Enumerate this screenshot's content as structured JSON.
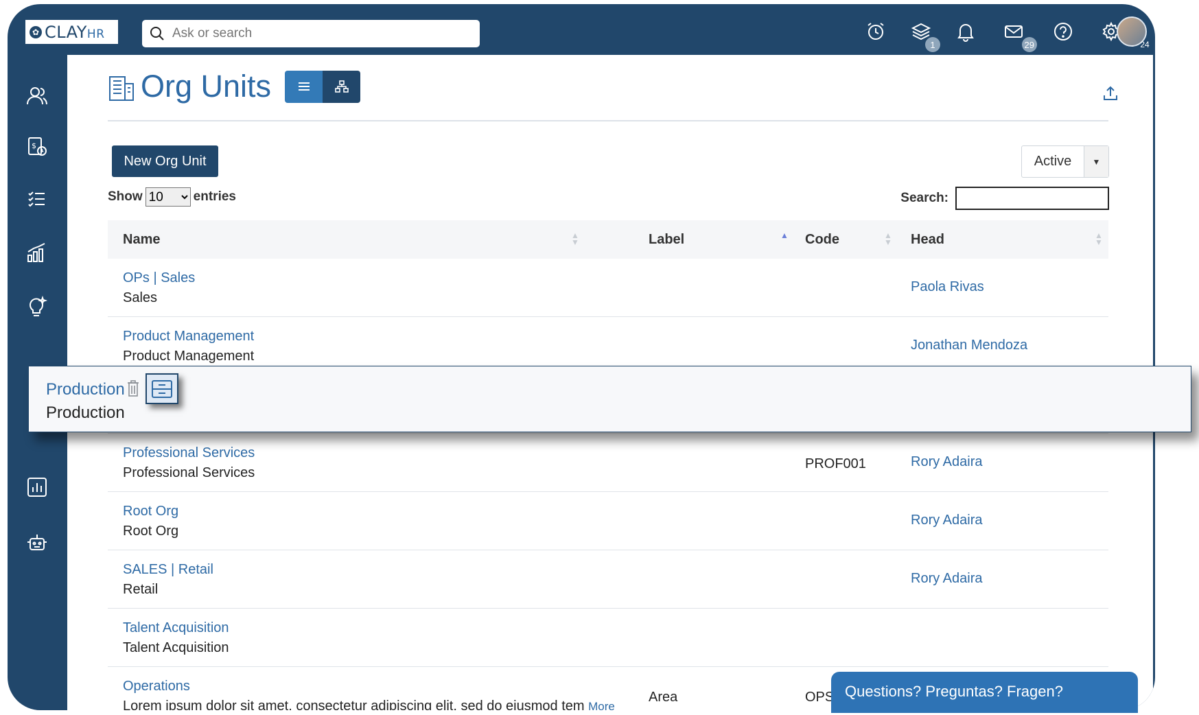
{
  "app": {
    "logo_text": "CLAY",
    "logo_suffix": "HR",
    "search_placeholder": "Ask or search"
  },
  "topbar": {
    "badges": {
      "layers": "1",
      "mail": "29",
      "avatar": "24"
    }
  },
  "page": {
    "title": "Org Units",
    "new_button": "New Org Unit",
    "status_filter": "Active",
    "show_label": "Show",
    "entries_label": "entries",
    "page_size": "10",
    "page_size_options": [
      "10"
    ],
    "search_label": "Search:"
  },
  "table": {
    "columns": [
      "Name",
      "Label",
      "Code",
      "Head"
    ],
    "rows": [
      {
        "name": "OPs | Sales",
        "sub": "Sales",
        "label": "",
        "code": "",
        "head": "Paola Rivas"
      },
      {
        "name": "Product Management",
        "sub": "Product Management",
        "label": "",
        "code": "",
        "head": "Jonathan Mendoza"
      },
      {
        "name": "Professional Services",
        "sub": "Professional Services",
        "label": "",
        "code": "PROF001",
        "head": "Rory Adaira"
      },
      {
        "name": "Root Org",
        "sub": "Root Org",
        "label": "",
        "code": "",
        "head": "Rory Adaira"
      },
      {
        "name": "SALES | Retail",
        "sub": "Retail",
        "label": "",
        "code": "",
        "head": "Rory Adaira"
      },
      {
        "name": "Talent Acquisition",
        "sub": "Talent Acquisition",
        "label": "",
        "code": "",
        "head": ""
      },
      {
        "name": "Operations",
        "sub": "Lorem ipsum dolor sit amet, consectetur adipiscing elit, sed do eiusmod tem",
        "more": "More",
        "label": "Area",
        "code": "OPS",
        "head": ""
      }
    ]
  },
  "dragged_row": {
    "name": "Production",
    "sub": "Production"
  },
  "chat": {
    "text": "Questions? Preguntas? Fragen?"
  },
  "colors": {
    "navy": "#21476b",
    "link": "#2e6aa5",
    "accent": "#337ab7"
  }
}
